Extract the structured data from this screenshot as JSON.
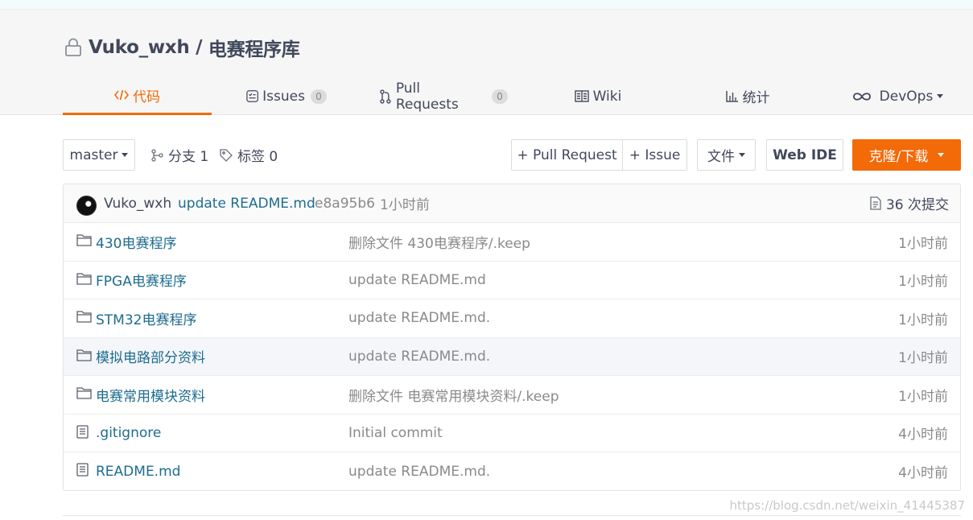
{
  "repo": {
    "owner": "Vuko_wxh",
    "separator": " / ",
    "name": "电赛程序库",
    "visibility_icon": "lock-icon"
  },
  "tabs": [
    {
      "label": "代码",
      "icon": "code-icon",
      "active": true
    },
    {
      "label": "Issues",
      "badge": "0",
      "icon": "issues-icon"
    },
    {
      "label": "Pull Requests",
      "badge": "0",
      "icon": "pull-request-icon"
    },
    {
      "label": "Wiki",
      "icon": "wiki-book-icon"
    },
    {
      "label": "统计",
      "icon": "bar-chart-icon"
    },
    {
      "label": "DevOps",
      "icon": "infinity-icon",
      "dropdown": true
    }
  ],
  "toolbar": {
    "branch": "master",
    "branches": "分支 1",
    "tags": "标签 0",
    "new_pr": "+ Pull Request",
    "new_issue": "+ Issue",
    "file_menu": "文件",
    "web_ide": "Web IDE",
    "clone": "克隆/下载"
  },
  "accent_color": "#f36a08",
  "last_commit": {
    "author": "Vuko_wxh",
    "message": "update README.md",
    "hash": "e8a95b6",
    "time": "1小时前",
    "count": "36 次提交"
  },
  "files": [
    {
      "type": "folder",
      "name": "430电赛程序",
      "message": "删除文件 430电赛程序/.keep",
      "time": "1小时前"
    },
    {
      "type": "folder",
      "name": "FPGA电赛程序",
      "message": "update README.md",
      "time": "1小时前"
    },
    {
      "type": "folder",
      "name": "STM32电赛程序",
      "message": "update README.md.",
      "time": "1小时前"
    },
    {
      "type": "folder",
      "name": "模拟电路部分资料",
      "message": "update README.md.",
      "time": "1小时前"
    },
    {
      "type": "folder",
      "name": "电赛常用模块资料",
      "message": "删除文件 电赛常用模块资料/.keep",
      "time": "1小时前"
    },
    {
      "type": "file",
      "name": ".gitignore",
      "message": "Initial commit",
      "time": "4小时前"
    },
    {
      "type": "file",
      "name": "README.md",
      "message": "update README.md.",
      "time": "4小时前"
    }
  ],
  "watermark": "https://blog.csdn.net/weixin_41445387"
}
